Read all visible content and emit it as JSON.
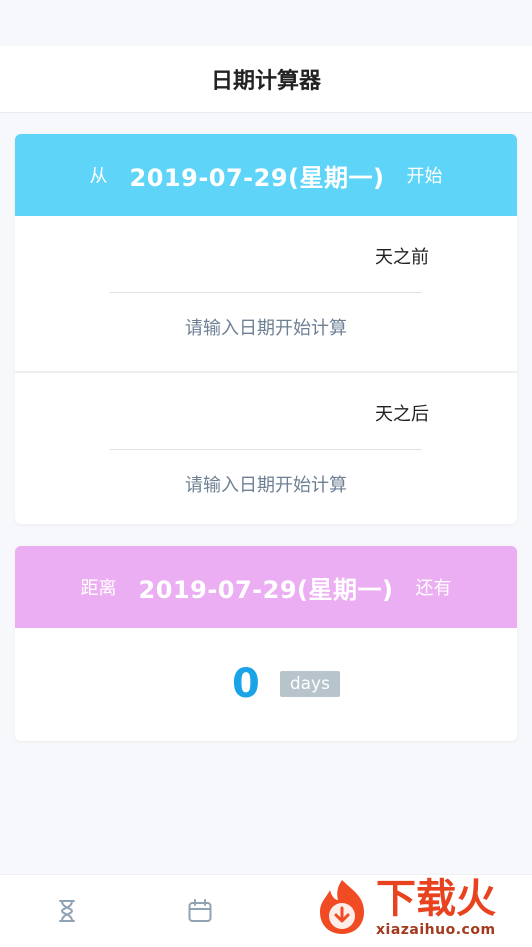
{
  "nav": {
    "title": "日期计算器"
  },
  "start_card": {
    "prefix": "从",
    "date": "2019-07-29(星期一)",
    "suffix": "开始",
    "before": {
      "unit": "天之前",
      "result": "请输入日期开始计算"
    },
    "after": {
      "unit": "天之后",
      "result": "请输入日期开始计算"
    }
  },
  "countdown_card": {
    "prefix": "距离",
    "date": "2019-07-29(星期一)",
    "suffix": "还有",
    "days_value": "0",
    "days_unit": "days"
  },
  "tabs": [
    {
      "name": "hourglass-icon"
    },
    {
      "name": "calendar-icon"
    }
  ],
  "watermark": {
    "text": "下载火",
    "url": "xiazaihuo.com"
  },
  "colors": {
    "start_header": "#5ed4f9",
    "countdown_header": "#ecaef3",
    "count_number": "#1aa3e6",
    "result_text": "#6e8194"
  }
}
